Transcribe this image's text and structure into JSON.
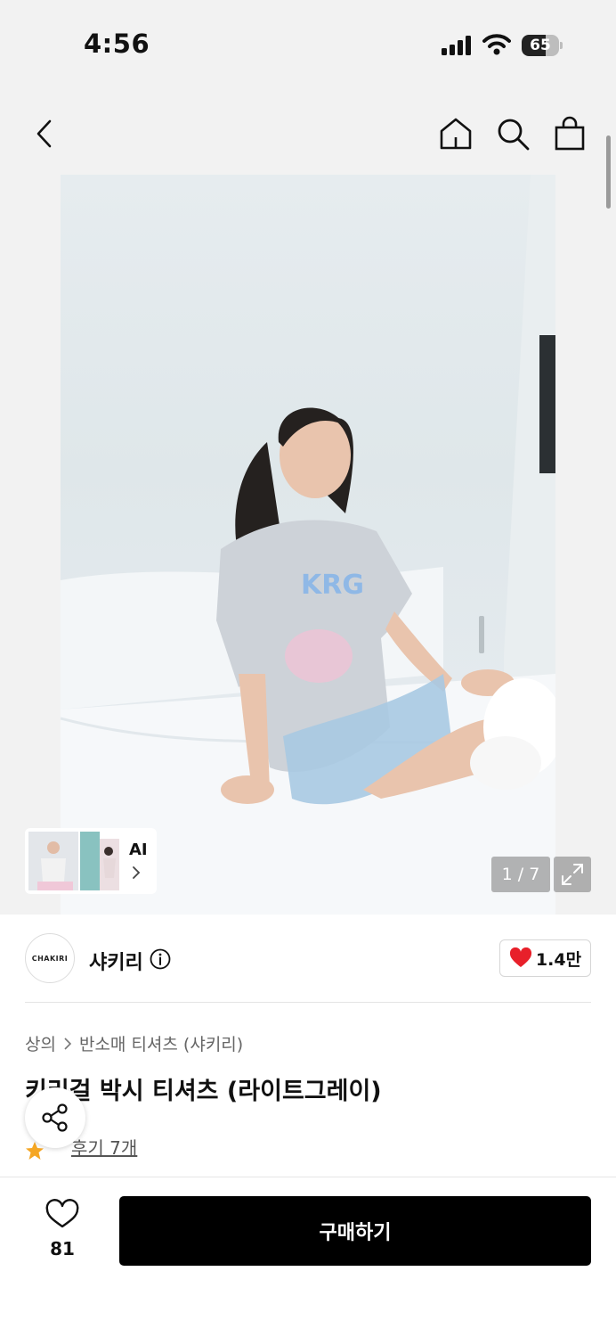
{
  "status_bar": {
    "time": "4:56",
    "battery": "65",
    "battery_level": 0.65
  },
  "nav": {
    "back_icon": "chevron-left-icon",
    "home_icon": "home-icon",
    "search_icon": "search-icon",
    "bag_icon": "shopping-bag-icon"
  },
  "gallery": {
    "page_counter": "1 / 7",
    "ai_label": "AI",
    "expand_icon": "expand-icon"
  },
  "brand": {
    "logo_text": "CHAKIRI",
    "name": "샤키리",
    "likes": "1.4만"
  },
  "product": {
    "breadcrumb": [
      "상의",
      "반소매 티셔츠 (샤키리)"
    ],
    "title": "키리걸 박시 티셔츠 (라이트그레이)",
    "review_link": "후기 7개"
  },
  "bottom_bar": {
    "wish_count": "81",
    "buy_label": "구매하기"
  },
  "colors": {
    "accent_heart": "#e8202a",
    "star": "#f5a623",
    "buy_bg": "#000000"
  }
}
